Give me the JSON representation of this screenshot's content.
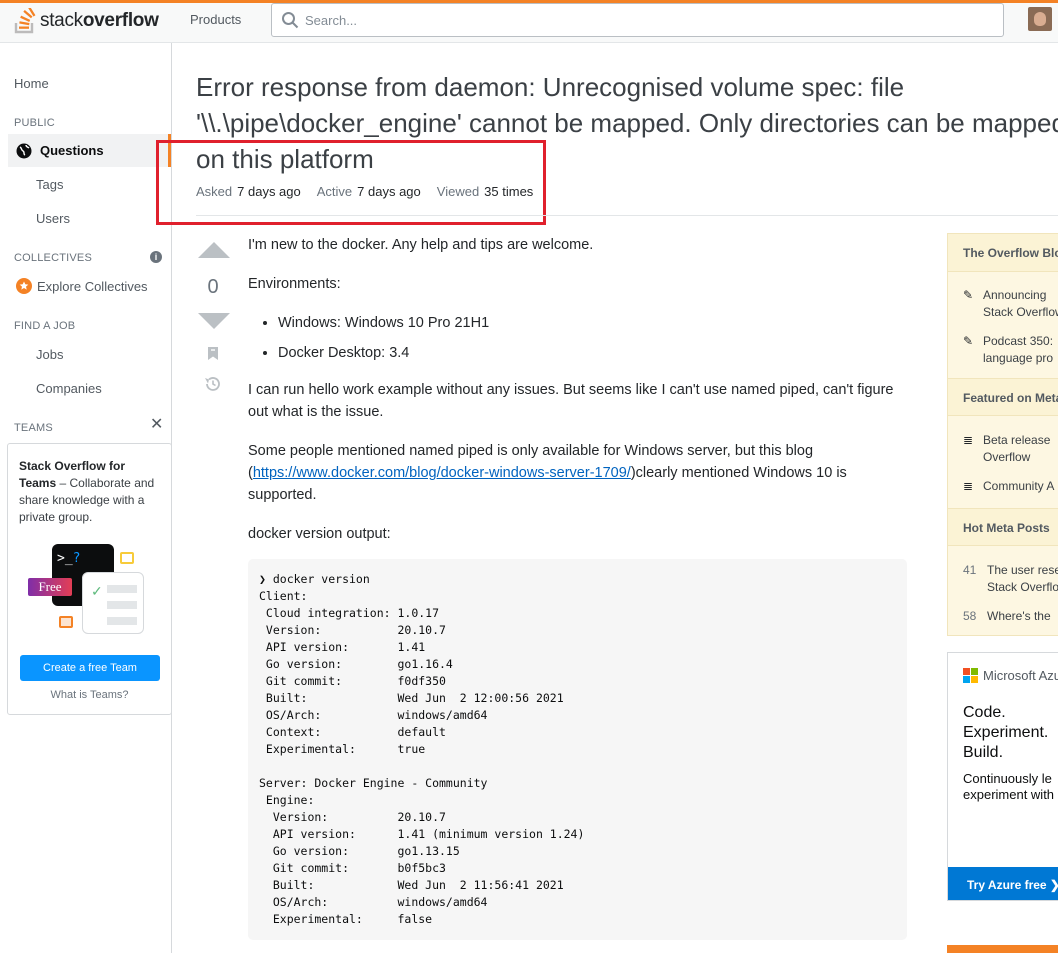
{
  "topbar": {
    "logo_text_light": "stack",
    "logo_text_bold": "overflow",
    "products_label": "Products",
    "search_placeholder": "Search..."
  },
  "leftnav": {
    "home": "Home",
    "public_heading": "PUBLIC",
    "questions": "Questions",
    "tags": "Tags",
    "users": "Users",
    "collectives_heading": "COLLECTIVES",
    "explore_collectives": "Explore Collectives",
    "find_job_heading": "FIND A JOB",
    "jobs": "Jobs",
    "companies": "Companies",
    "teams_heading": "TEAMS",
    "teams_promo_bold": "Stack Overflow for Teams",
    "teams_promo_text": " – Collaborate and share knowledge with a private group.",
    "free_badge": "Free",
    "create_team_button": "Create a free Team",
    "what_is_teams": "What is Teams?"
  },
  "question": {
    "title_line1": "Error response from daemon: Unrecognised volume spec: file",
    "title_line2": "'\\\\.\\pipe\\docker_engine' cannot be mapped. Only directories can be mapped",
    "title_line3": "on this platform",
    "asked_label": "Asked",
    "asked_value": "7 days ago",
    "active_label": "Active",
    "active_value": "7 days ago",
    "viewed_label": "Viewed",
    "viewed_value": "35 times",
    "vote_count": "0",
    "body_p1": "I'm new to the docker. Any help and tips are welcome.",
    "body_p2": "Environments:",
    "env_items": [
      "Windows: Windows 10 Pro 21H1",
      "Docker Desktop: 3.4"
    ],
    "body_p3": "I can run hello work example without any issues. But seems like I can't use named piped, can't figure out what is the issue.",
    "body_p4_before": "Some people mentioned named piped is only available for Windows server, but this blog (",
    "body_p4_link": "https://www.docker.com/blog/docker-windows-server-1709/",
    "body_p4_after": ")clearly mentioned Windows 10 is supported.",
    "body_p5": "docker version output:",
    "code": "❯ docker version\nClient:\n Cloud integration: 1.0.17\n Version:           20.10.7\n API version:       1.41\n Go version:        go1.16.4\n Git commit:        f0df350\n Built:             Wed Jun  2 12:00:56 2021\n OS/Arch:           windows/amd64\n Context:           default\n Experimental:      true\n\nServer: Docker Engine - Community\n Engine:\n  Version:          20.10.7\n  API version:      1.41 (minimum version 1.24)\n  Go version:       go1.13.15\n  Git commit:       b0f5bc3\n  Built:            Wed Jun  2 11:56:41 2021\n  OS/Arch:          windows/amd64\n  Experimental:     false"
  },
  "sidebar_widget": {
    "blog_heading": "The Overflow Blog",
    "blog_items": [
      {
        "line1": "Announcing",
        "line2": "Stack Overflow"
      },
      {
        "line1": "Podcast 350:",
        "line2": "language pro"
      }
    ],
    "featured_heading": "Featured on Meta",
    "featured_items": [
      {
        "line1": "Beta release",
        "line2": "Overflow"
      },
      {
        "line1": "Community A",
        "line2": ""
      }
    ],
    "hot_heading": "Hot Meta Posts",
    "hot_items": [
      {
        "num": "41",
        "line1": "The user rese",
        "line2": "Stack Overflo"
      },
      {
        "num": "58",
        "line1": "Where's the",
        "line2": ""
      }
    ]
  },
  "ad": {
    "brand": "Microsoft Azure",
    "headline": [
      "Code.",
      "Experiment.",
      "Build."
    ],
    "text_line1": "Continuously le",
    "text_line2": "experiment with",
    "button": "Try Azure free ❯"
  },
  "colors": {
    "accent": "#f48225",
    "link": "#0063bf",
    "highlight_box": "#e0202d",
    "button_blue": "#0a95ff"
  }
}
